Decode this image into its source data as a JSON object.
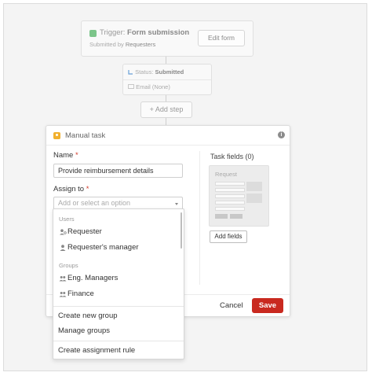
{
  "trigger": {
    "prefix": "Trigger:",
    "title": "Form submission",
    "sub_prefix": "Submitted by",
    "sub_value": "Requesters",
    "edit_label": "Edit form"
  },
  "status": {
    "status_label": "Status:",
    "status_value": "Submitted",
    "email_label": "Email (None)"
  },
  "add_step_label": "+ Add step",
  "panel": {
    "title": "Manual task",
    "info_icon": "i",
    "name_label": "Name",
    "name_value": "Provide reimbursement details",
    "assign_label": "Assign to",
    "required_mark": "*",
    "assign_placeholder": "Add or select an option",
    "task_fields_title": "Task fields (0)",
    "request_preview_title": "Request",
    "add_fields_label": "Add fields",
    "cancel_label": "Cancel",
    "save_label": "Save"
  },
  "dropdown": {
    "users_header": "Users",
    "users": [
      "Requester",
      "Requester's manager"
    ],
    "groups_header": "Groups",
    "groups": [
      "Eng. Managers",
      "Finance"
    ],
    "actions": [
      "Create new group",
      "Manage groups"
    ],
    "rule_action": "Create assignment rule"
  },
  "colors": {
    "save_button": "#c9291f",
    "required_mark": "#d13a2a",
    "trigger_icon": "#7cc58a",
    "task_icon": "#f1b02e"
  },
  "icons": {
    "trigger": "bolt-icon",
    "status": "status-icon",
    "email": "mail-icon",
    "manual_task": "person-badge-icon",
    "info": "info-icon",
    "user": "person-icon",
    "group": "group-icon"
  }
}
